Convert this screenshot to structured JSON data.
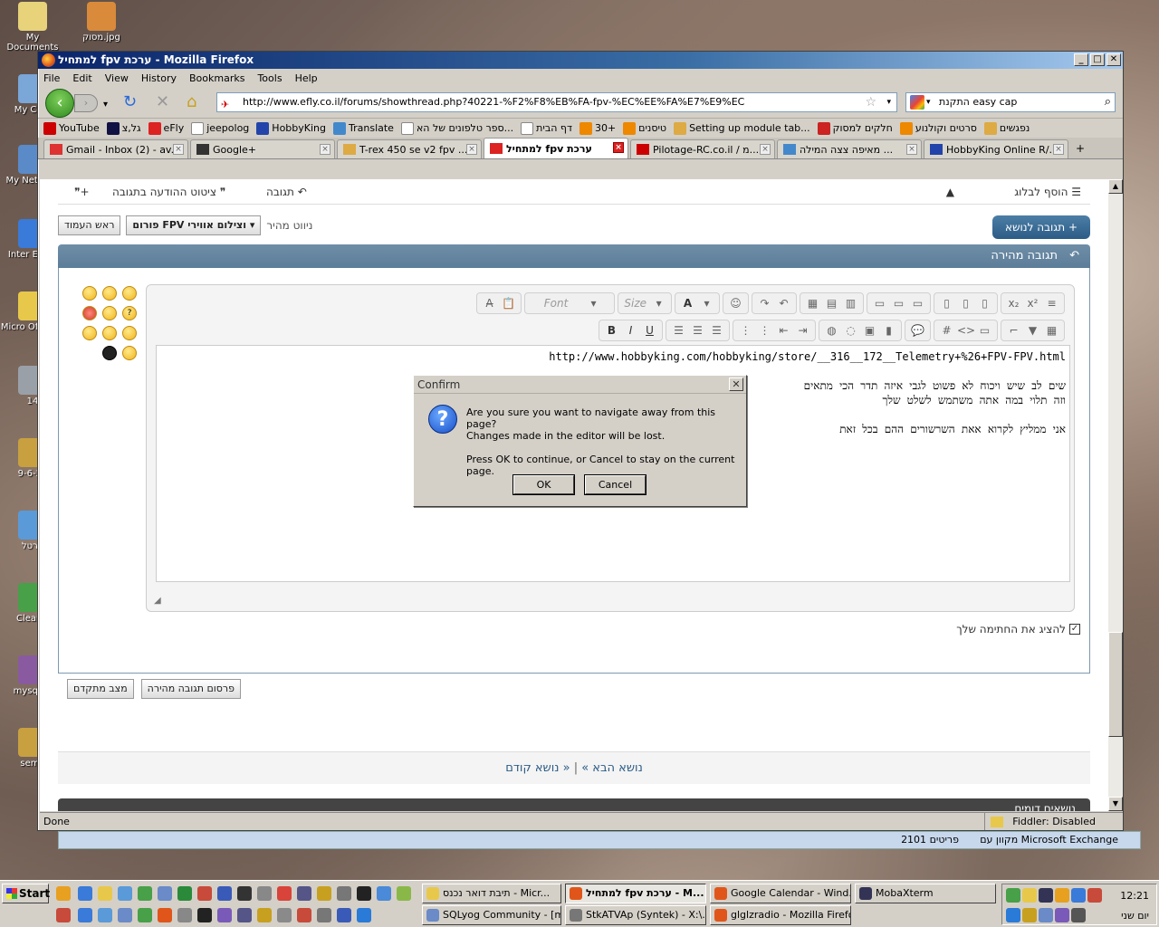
{
  "desktop": {
    "icons": [
      {
        "label": "My Documents",
        "color": "#e8d27a"
      },
      {
        "label": "מסוק.jpg",
        "color": "#d98a3a"
      },
      {
        "label": "My Com",
        "color": "#7aa6d8"
      },
      {
        "label": "My Net Plac",
        "color": "#5a8ac8"
      },
      {
        "label": "Inter Explo",
        "color": "#3a7ad8"
      },
      {
        "label": "Micro Office O",
        "color": "#e8c84a"
      },
      {
        "label": "14",
        "color": "#9aa0a8"
      },
      {
        "label": "9-6-20",
        "color": "#c8a040"
      },
      {
        "label": "ערטל",
        "color": "#5a9ad8"
      },
      {
        "label": "ClearW",
        "color": "#48a048"
      },
      {
        "label": "mysqldu",
        "color": "#8a5aa0"
      },
      {
        "label": "seme",
        "color": "#c8a040"
      }
    ]
  },
  "window": {
    "title": "למתחיל fpv ערכת - Mozilla Firefox",
    "buttons": [
      "_",
      "□",
      "✕"
    ],
    "menu": [
      "File",
      "Edit",
      "View",
      "History",
      "Bookmarks",
      "Tools",
      "Help"
    ],
    "url": "http://www.efly.co.il/forums/showthread.php?40221-%F2%F8%EB%FA-fpv-%EC%EE%FA%E7%E9%EC",
    "search_value": "התקנת easy cap",
    "bookmarks": [
      {
        "label": "YouTube",
        "color": "#c00"
      },
      {
        "label": "גל,צ",
        "color": "#114"
      },
      {
        "label": "eFly",
        "color": "#d22"
      },
      {
        "label": "jeepolog",
        "color": "#fff"
      },
      {
        "label": "HobbyKing",
        "color": "#24a"
      },
      {
        "label": "Translate",
        "color": "#48c"
      },
      {
        "label": "ספר טלפונים של הא...",
        "color": "#fff"
      },
      {
        "label": "דף הבית",
        "color": "#fff"
      },
      {
        "label": "30+",
        "color": "#e80"
      },
      {
        "label": "טיסנים",
        "color": "#e80"
      },
      {
        "label": "Setting up module tab...",
        "color": "#da4"
      },
      {
        "label": "חלקים למסוק",
        "color": "#c22"
      },
      {
        "label": "סרטים וקולנוע",
        "color": "#e80"
      },
      {
        "label": "נפגשים",
        "color": "#da4"
      }
    ],
    "tabs": [
      {
        "label": "Gmail - Inbox (2) - av...",
        "color": "#d33",
        "active": false
      },
      {
        "label": "Google+",
        "color": "#333",
        "active": false
      },
      {
        "label": "T-rex 450 se v2 fpv ...",
        "color": "#da4",
        "active": false
      },
      {
        "label": "למתחיל fpv ערכת",
        "color": "#d22",
        "active": true
      },
      {
        "label": "Pilotage-RC.co.il / מ...",
        "color": "#c00",
        "active": false
      },
      {
        "label": "מאיפה צצה המילה ...",
        "color": "#48c",
        "active": false
      },
      {
        "label": "HobbyKing Online R/...",
        "color": "#24a",
        "active": false
      }
    ],
    "status_left": "Done",
    "status_right": "Fiddler: Disabled"
  },
  "page": {
    "top_actions": {
      "add_blog": "הוסף לבלוג",
      "reply": "תגובה",
      "quote_reply": "ציטוט ההודעה בתגובה"
    },
    "quick_nav_label": "ניווט מהיר",
    "forum_select": "פורום FPV וצילום אווירי",
    "top_btn": "ראש העמוד",
    "reply_to_thread": "תגובה לנושא",
    "quick_reply_title": "תגובה מהירה",
    "toolbar_font": "Font",
    "toolbar_size": "Size",
    "editor_lines": [
      "http://www.hobbyking.com/hobbyking/store/__316__172__Telemetry+%26+FPV-FPV.html",
      "",
      "שים לב שיש ויכוח לא פשוט לגבי איזה תדר הכי מתאים",
      "וזה תלוי במה אתה משתמש לשלט שלך",
      "",
      "אני ממליץ לקרוא אאת השרשורים ההם בכל זאת"
    ],
    "show_signature": "להציג את החתימה שלך",
    "post_quick": "פרסום תגובה מהירה",
    "advanced": "מצב מתקדם",
    "prev_thread": "« נושא קודם",
    "next_thread": "נושא הבא »",
    "similar": "נושאים דומים",
    "exchange": "מקוון עם Microsoft Exchange",
    "items": "2101 פריטים"
  },
  "dialog": {
    "title": "Confirm",
    "line1": "Are you sure you want to navigate away from this page?",
    "line2": "Changes made in the editor will be lost.",
    "line3": "Press OK to continue, or Cancel to stay on the current page.",
    "ok": "OK",
    "cancel": "Cancel"
  },
  "taskbar": {
    "start": "Start",
    "tasks_row1": [
      {
        "label": "תיבת דואר נכנס - Micr...",
        "color": "#e8c84a",
        "active": false
      },
      {
        "label": "למתחיל fpv ערכת - M...",
        "color": "#e0561a",
        "active": true
      },
      {
        "label": "Google Calendar - Wind...",
        "color": "#e0561a",
        "active": false
      },
      {
        "label": "MobaXterm",
        "color": "#335",
        "active": false
      }
    ],
    "tasks_row2": [
      {
        "label": "SQLyog Community - [m...",
        "color": "#6a8ac8",
        "active": false
      },
      {
        "label": "StkATVAp (Syntek) - X:\\...",
        "color": "#777",
        "active": false
      },
      {
        "label": "glglzradio - Mozilla Firefox",
        "color": "#e0561a",
        "active": false
      }
    ],
    "clock": "12:21",
    "day": "יום שני"
  }
}
